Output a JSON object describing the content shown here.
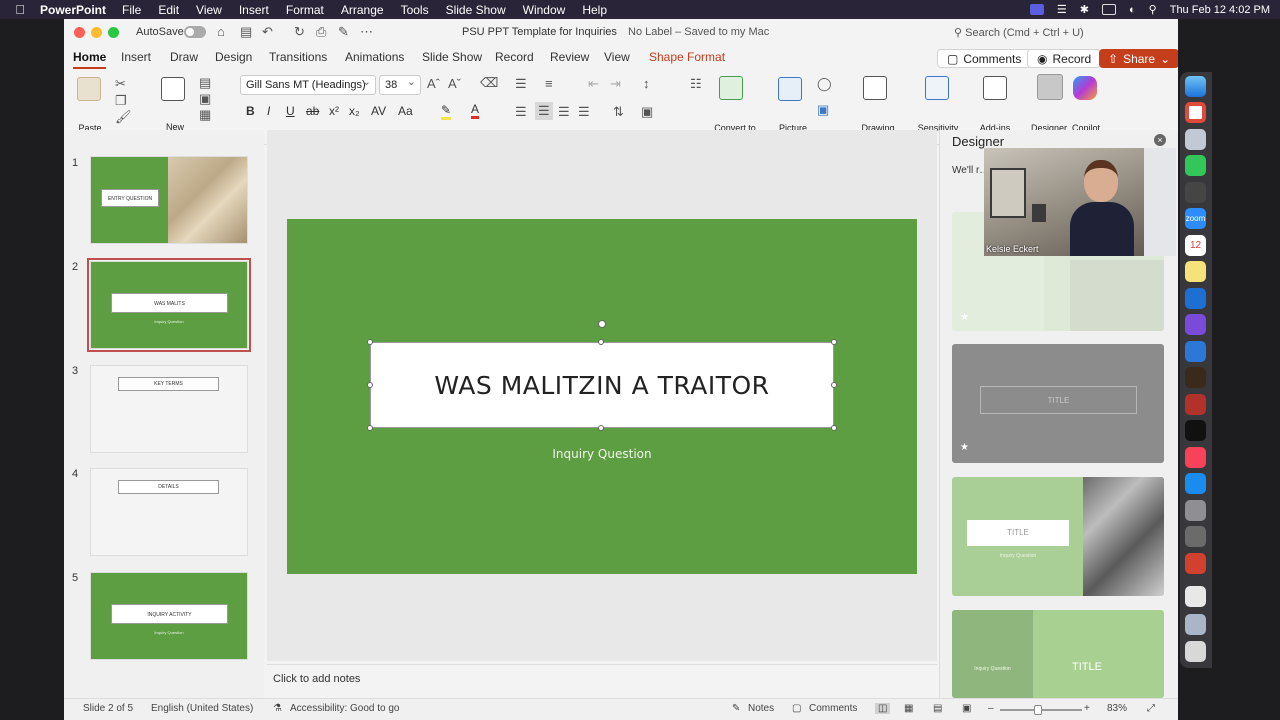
{
  "menubar": {
    "app_name": "PowerPoint",
    "menus": [
      "File",
      "Edit",
      "View",
      "Insert",
      "Format",
      "Arrange",
      "Tools",
      "Slide Show",
      "Window",
      "Help"
    ],
    "clock": "Thu Feb 12  4:02 PM"
  },
  "titlebar": {
    "autosave": "AutoSave",
    "doc_title": "PSU PPT Template for Inquiries",
    "label_status": "No Label – Saved to my Mac",
    "search_placeholder": "Search (Cmd + Ctrl + U)"
  },
  "tabs": [
    "Home",
    "Insert",
    "Draw",
    "Design",
    "Transitions",
    "Animations",
    "Slide Show",
    "Record",
    "Review",
    "View",
    "Shape Format"
  ],
  "actions": {
    "comments": "Comments",
    "record": "Record",
    "share": "Share"
  },
  "ribbon": {
    "paste": "Paste",
    "new_slide": "New\nSlide",
    "font_name": "Gill Sans MT (Headings)",
    "font_size": "38",
    "convert_smartart": "Convert to\nSmartArt",
    "picture": "Picture",
    "drawing": "Drawing",
    "sensitivity": "Sensitivity",
    "addins": "Add-ins",
    "designer": "Designer",
    "copilot": "Copilot"
  },
  "slides": [
    {
      "num": "1",
      "title": "ENTRY QUESTION"
    },
    {
      "num": "2",
      "title": "WAS MALITS",
      "subtitle": "Inquiry Question"
    },
    {
      "num": "3",
      "title": "KEY TERMS"
    },
    {
      "num": "4",
      "title": "DETAILS"
    },
    {
      "num": "5",
      "title": "INQUIRY ACTIVITY",
      "subtitle": "Inquiry Question"
    }
  ],
  "current_slide": {
    "title": "WAS MALITZIN A TRAITOR",
    "subtitle": "Inquiry Question"
  },
  "notes_placeholder": "Click to add notes",
  "designer": {
    "title": "Designer",
    "message": "We'll r… done c…",
    "card_title": "TITLE",
    "card_sub": "Inquiry Question"
  },
  "video": {
    "name": "Kelsie Eckert"
  },
  "status": {
    "slide_counter": "Slide 2 of 5",
    "language": "English (United States)",
    "accessibility": "Accessibility: Good to go",
    "notes": "Notes",
    "comments": "Comments",
    "zoom": "83%"
  },
  "colors": {
    "slide_green": "#5e9e43",
    "accent": "#c43e1c"
  },
  "dock": {
    "calendar_day": "12"
  }
}
